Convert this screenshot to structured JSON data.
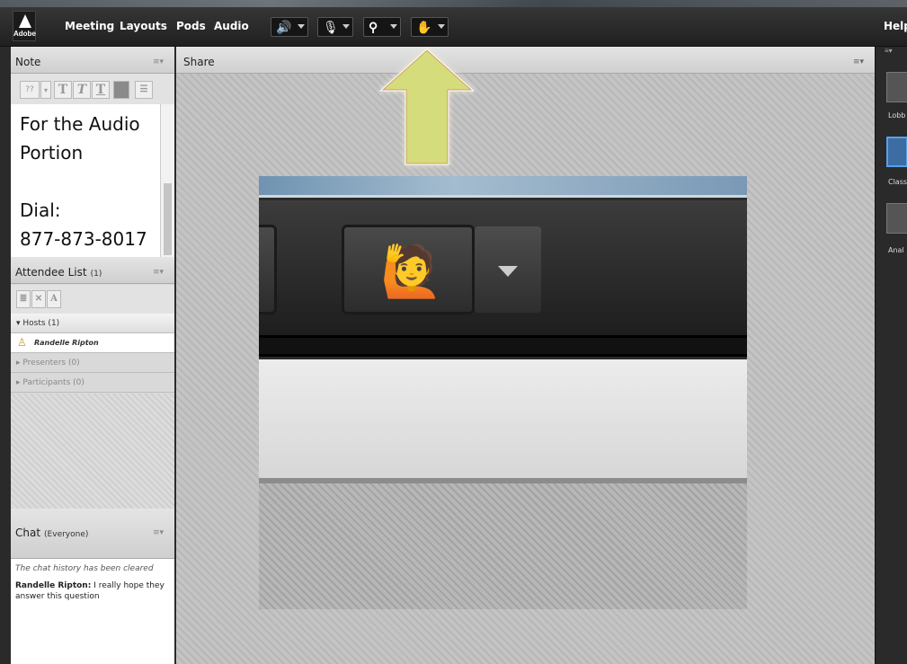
{
  "menubar": {
    "logo_text": "Adobe",
    "items": [
      "Meeting",
      "Layouts",
      "Pods",
      "Audio"
    ],
    "tools": [
      {
        "icon": "speaker-icon",
        "color": "#5bd21e"
      },
      {
        "icon": "microphone-icon",
        "color": "#ffffff"
      },
      {
        "icon": "webcam-icon",
        "color": "#ffffff"
      },
      {
        "icon": "raise-hand-icon",
        "color": "#bbbbbb"
      }
    ],
    "help": "Help"
  },
  "note_pod": {
    "title": "Note",
    "font_size": "??",
    "content_lines": [
      "For the Audio",
      "Portion",
      "",
      "Dial:",
      "877-873-8017"
    ]
  },
  "attendee_pod": {
    "title": "Attendee List",
    "count": "(1)",
    "groups": [
      {
        "label": "Hosts (1)",
        "expanded": true
      },
      {
        "label": "Presenters (0)",
        "expanded": false
      },
      {
        "label": "Participants (0)",
        "expanded": false
      }
    ],
    "host_name": "Randelle Ripton"
  },
  "chat_pod": {
    "title": "Chat",
    "scope": "(Everyone)",
    "cleared_notice": "The chat history has been cleared",
    "message_sender": "Randelle Ripton:",
    "message_text": "I really hope they answer this question"
  },
  "share_pod": {
    "title": "Share"
  },
  "layouts_panel": {
    "items": [
      {
        "label": "Lobb",
        "selected": false
      },
      {
        "label": "Class",
        "selected": true
      },
      {
        "label": "Anal",
        "selected": false
      }
    ]
  },
  "colors": {
    "arrow_fill": "#d4dc7c",
    "accent": "#5aa0e6"
  }
}
